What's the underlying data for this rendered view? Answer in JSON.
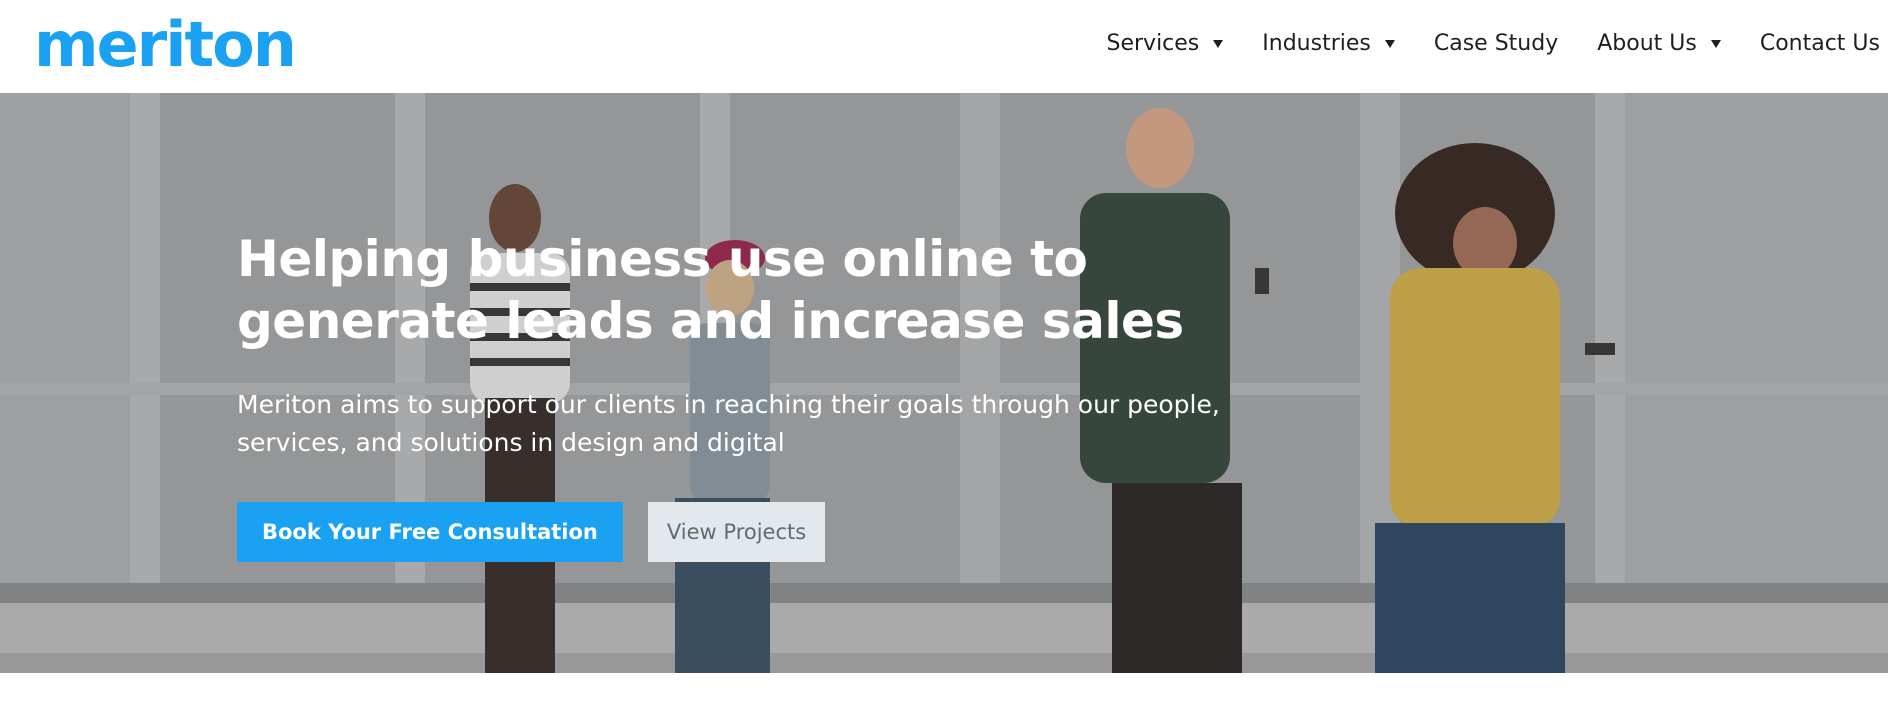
{
  "brand": {
    "logo_text": "meriton",
    "logo_color": "#1ba1f1"
  },
  "nav": {
    "items": [
      {
        "label": "Services",
        "has_dropdown": true
      },
      {
        "label": "Industries",
        "has_dropdown": true
      },
      {
        "label": "Case Study",
        "has_dropdown": false
      },
      {
        "label": "About Us",
        "has_dropdown": true
      },
      {
        "label": "Contact Us",
        "has_dropdown": false
      }
    ]
  },
  "hero": {
    "title_line1": "Helping business use online to",
    "title_line2": "generate leads and increase sales",
    "subtitle": "Meriton aims to support our clients in reaching their goals through our people, services, and solutions in design and digital",
    "primary_button": "Book Your Free Consultation",
    "secondary_button": "View Projects",
    "primary_color": "#1ba1f1"
  }
}
